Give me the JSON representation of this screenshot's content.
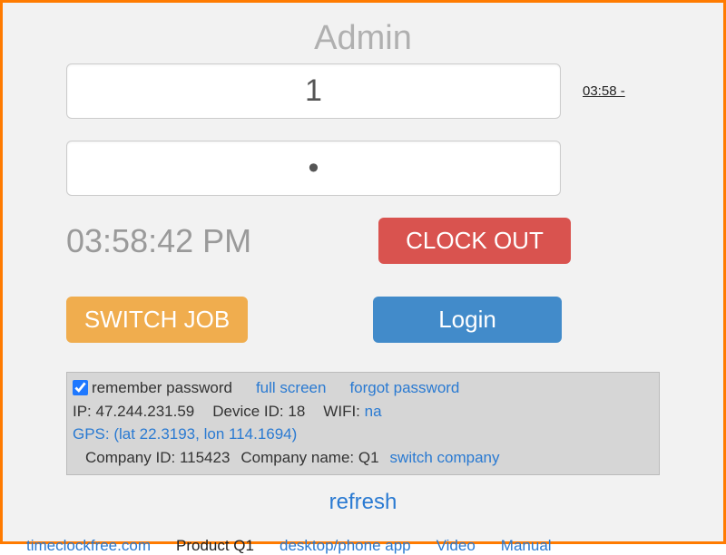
{
  "header": {
    "title": "Admin",
    "side_time": "03:58 -"
  },
  "inputs": {
    "id_value": "1",
    "password_value": "•"
  },
  "clock": {
    "time": "03:58:42 PM"
  },
  "buttons": {
    "clock_out": "CLOCK OUT",
    "switch_job": "SWITCH JOB",
    "login": "Login"
  },
  "info": {
    "remember_label": "remember password",
    "full_screen": "full screen",
    "forgot_password": "forgot password",
    "ip_label": "IP: ",
    "ip_value": "47.244.231.59",
    "device_label": "Device ID: ",
    "device_value": "18",
    "wifi_label": "WIFI: ",
    "wifi_value": "na",
    "gps": "GPS: (lat 22.3193, lon 114.1694)",
    "company_id_label": "Company ID: ",
    "company_id_value": "115423",
    "company_name_label": "Company name: ",
    "company_name_value": "Q1",
    "switch_company": "switch company"
  },
  "refresh": "refresh",
  "footer": {
    "site": "timeclockfree.com",
    "product": "Product Q1",
    "app": "desktop/phone app",
    "video": "Video",
    "manual": "Manual"
  }
}
